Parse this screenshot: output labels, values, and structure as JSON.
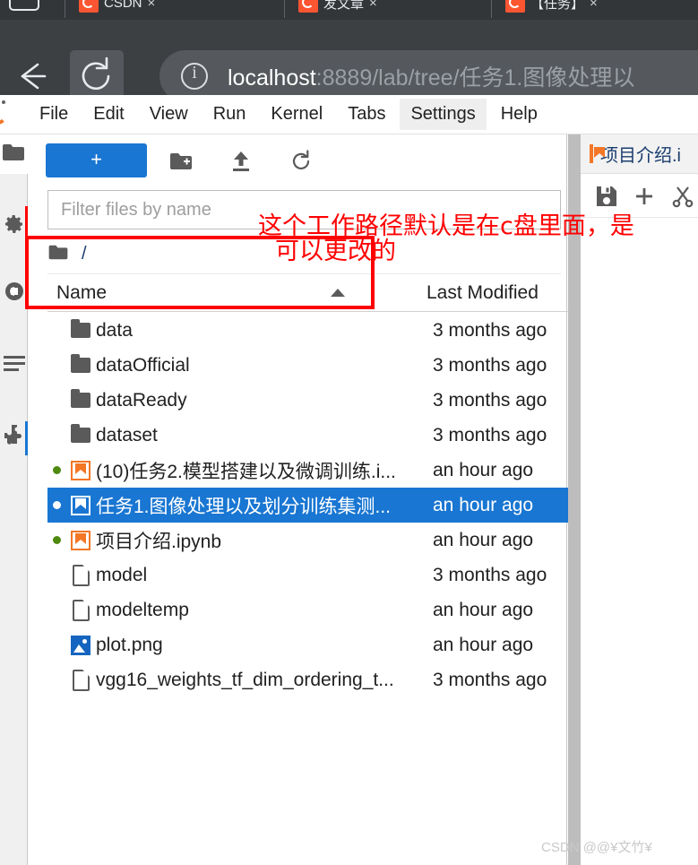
{
  "browser": {
    "tabs": [
      {
        "title": "CSDN",
        "favicon": "csdn-favicon",
        "close": "×"
      },
      {
        "title": "发文章",
        "favicon": "csdn-favicon",
        "close": "×"
      },
      {
        "title": "【任务】",
        "favicon": "csdn-favicon",
        "close": "×"
      }
    ],
    "back_icon": "back-arrow-icon",
    "reload_icon": "reload-icon",
    "site_info_icon": "site-info-icon",
    "url_host": "localhost",
    "url_path": ":8889/lab/tree/任务1.图像处理以"
  },
  "jupyter": {
    "logo": "jupyter-logo",
    "menu": [
      {
        "label": "File",
        "active": false
      },
      {
        "label": "Edit",
        "active": false
      },
      {
        "label": "View",
        "active": false
      },
      {
        "label": "Run",
        "active": false
      },
      {
        "label": "Kernel",
        "active": false
      },
      {
        "label": "Tabs",
        "active": false
      },
      {
        "label": "Settings",
        "active": true
      },
      {
        "label": "Help",
        "active": false
      }
    ],
    "rail": [
      {
        "name": "file-browser-icon",
        "selected": true,
        "accent": ""
      },
      {
        "name": "running-terminals-icon",
        "selected": false,
        "accent": "#ff0000"
      },
      {
        "name": "commands-icon",
        "selected": false,
        "accent": ""
      },
      {
        "name": "table-of-contents-icon",
        "selected": false,
        "accent": ""
      },
      {
        "name": "extension-manager-icon",
        "selected": false,
        "accent": "#1976d2"
      }
    ],
    "filebrowser": {
      "new_launcher_label": "+",
      "toolbar_icons": [
        {
          "name": "new-folder-icon"
        },
        {
          "name": "upload-icon"
        },
        {
          "name": "refresh-icon"
        }
      ],
      "filter_placeholder": "Filter files by name",
      "filter_value": "",
      "breadcrumb_root": "/",
      "breadcrumb_folder_icon": "folder-icon",
      "columns": {
        "name": "Name",
        "last_modified": "Last Modified"
      },
      "sort_indicator": "sort-ascending-caret",
      "items": [
        {
          "name": "data",
          "modified": "3 months ago",
          "icon": "folder",
          "running": false,
          "selected": false
        },
        {
          "name": "dataOfficial",
          "modified": "3 months ago",
          "icon": "folder",
          "running": false,
          "selected": false
        },
        {
          "name": "dataReady",
          "modified": "3 months ago",
          "icon": "folder",
          "running": false,
          "selected": false
        },
        {
          "name": "dataset",
          "modified": "3 months ago",
          "icon": "folder",
          "running": false,
          "selected": false
        },
        {
          "name": "(10)任务2.模型搭建以及微调训练.i...",
          "modified": "an hour ago",
          "icon": "notebook",
          "running": true,
          "selected": false
        },
        {
          "name": "任务1.图像处理以及划分训练集测...",
          "modified": "an hour ago",
          "icon": "notebook",
          "running": true,
          "selected": true
        },
        {
          "name": "项目介绍.ipynb",
          "modified": "an hour ago",
          "icon": "notebook",
          "running": true,
          "selected": false
        },
        {
          "name": "model",
          "modified": "3 months ago",
          "icon": "file",
          "running": false,
          "selected": false
        },
        {
          "name": "modeltemp",
          "modified": "an hour ago",
          "icon": "file",
          "running": false,
          "selected": false
        },
        {
          "name": "plot.png",
          "modified": "an hour ago",
          "icon": "image",
          "running": false,
          "selected": false
        },
        {
          "name": "vgg16_weights_tf_dim_ordering_t...",
          "modified": "3 months ago",
          "icon": "file",
          "running": false,
          "selected": false
        }
      ]
    },
    "dock": {
      "tab_icon": "notebook-icon",
      "tab_label": "项目介绍.i",
      "toolbar_icons": [
        {
          "name": "save-icon"
        },
        {
          "name": "insert-cell-icon"
        },
        {
          "name": "cut-icon"
        }
      ]
    }
  },
  "annotations": {
    "line1": "这个工作路径默认是在c盘里面，是",
    "line2": "可以更改的",
    "rect": "highlight-rectangle",
    "color": "#ff0000"
  },
  "watermark": "CSDN @@¥文竹¥",
  "colors": {
    "accent_blue": "#1976d2",
    "jupyter_orange": "#f37726",
    "running_green": "#4f8a10",
    "annotation_red": "#ff0000"
  }
}
